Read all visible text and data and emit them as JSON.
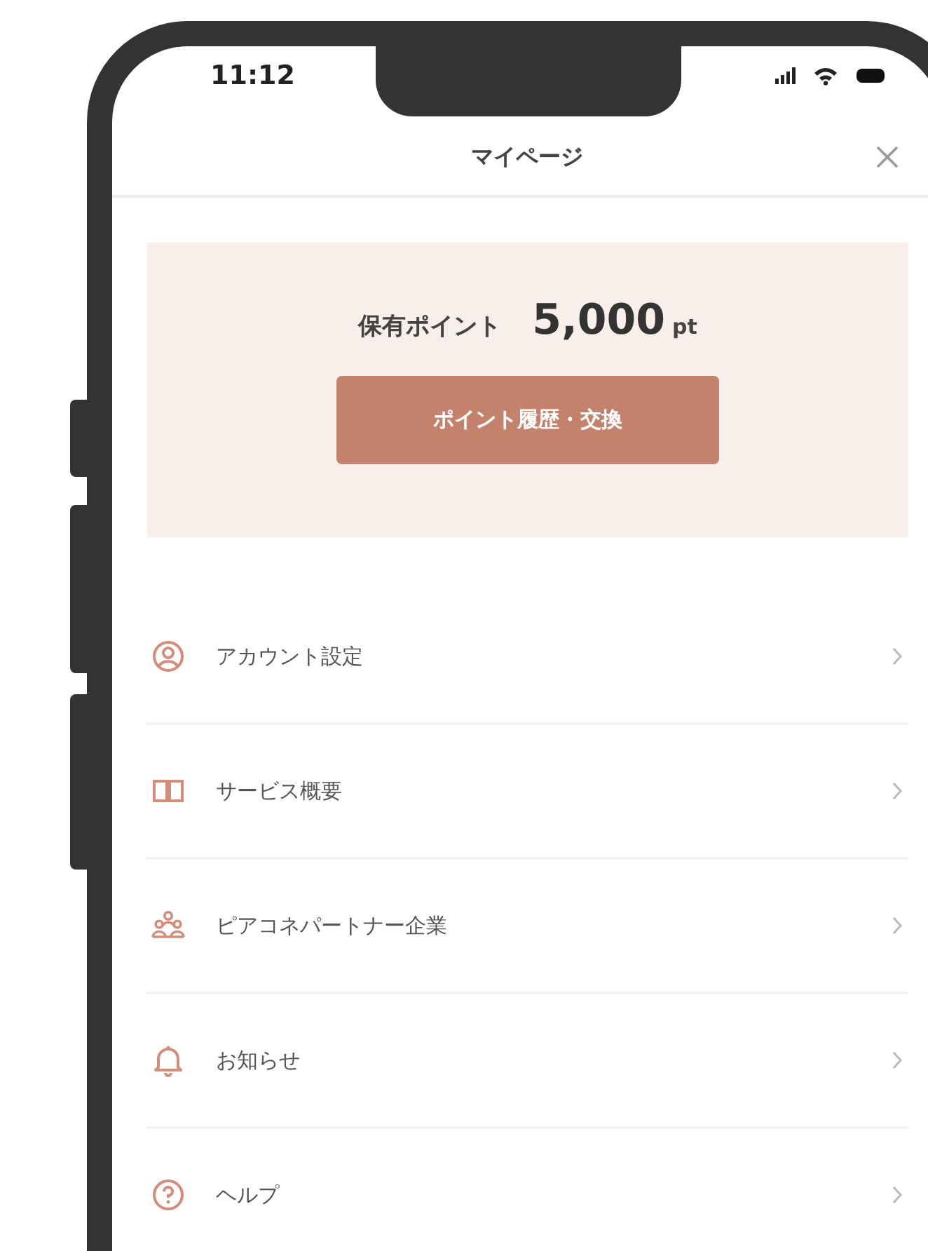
{
  "status_bar": {
    "time": "11:12"
  },
  "header": {
    "title": "マイページ"
  },
  "points": {
    "label": "保有ポイント",
    "amount": "5,000",
    "unit": "pt",
    "button": "ポイント履歴・交換"
  },
  "menu": [
    {
      "kind": "account",
      "label": "アカウント設定"
    },
    {
      "kind": "book",
      "label": "サービス概要"
    },
    {
      "kind": "group",
      "label": "ピアコネパートナー企業"
    },
    {
      "kind": "bell",
      "label": "お知らせ"
    },
    {
      "kind": "help",
      "label": "ヘルプ"
    }
  ]
}
